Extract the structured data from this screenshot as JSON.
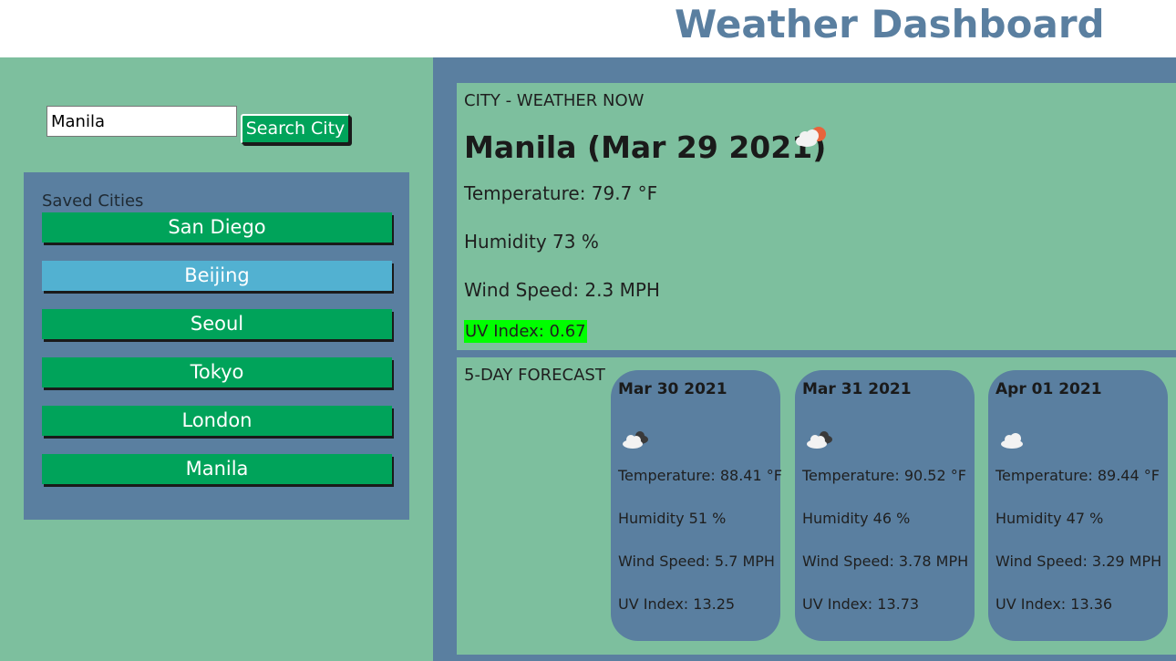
{
  "header": {
    "title": "Weather Dashboard"
  },
  "search": {
    "value": "Manila",
    "button_label": "Search City"
  },
  "saved": {
    "title": "Saved Cities",
    "cities": [
      "San Diego",
      "Beijing",
      "Seoul",
      "Tokyo",
      "London",
      "Manila"
    ],
    "active_city": "Beijing"
  },
  "current": {
    "section_label": "CITY - WEATHER NOW",
    "title": "Manila (Mar 29 2021)",
    "icon": "cloud-sun-icon",
    "temperature": "Temperature: 79.7 °F",
    "humidity": "Humidity 73 %",
    "wind": "Wind Speed: 2.3 MPH",
    "uv": "UV Index: 0.67",
    "uv_color": "#00ff00"
  },
  "forecast": {
    "section_label": "5-DAY FORECAST",
    "days": [
      {
        "date": "Mar 30 2021",
        "icon": "broken-clouds-icon",
        "temperature": "Temperature: 88.41 °F",
        "humidity": "Humidity 51 %",
        "wind": "Wind Speed: 5.7 MPH",
        "uv": "UV Index: 13.25"
      },
      {
        "date": "Mar 31 2021",
        "icon": "broken-clouds-icon",
        "temperature": "Temperature: 90.52 °F",
        "humidity": "Humidity 46 %",
        "wind": "Wind Speed: 3.78 MPH",
        "uv": "UV Index: 13.73"
      },
      {
        "date": "Apr 01 2021",
        "icon": "cloud-icon",
        "temperature": "Temperature: 89.44 °F",
        "humidity": "Humidity 47 %",
        "wind": "Wind Speed: 3.29 MPH",
        "uv": "UV Index: 13.36"
      }
    ]
  },
  "colors": {
    "header_text": "#5a7fa0",
    "panel_green": "#7dbf9e",
    "panel_blue": "#5a7fa0",
    "button_green": "#00a35a",
    "active_city": "#52b1d1"
  }
}
